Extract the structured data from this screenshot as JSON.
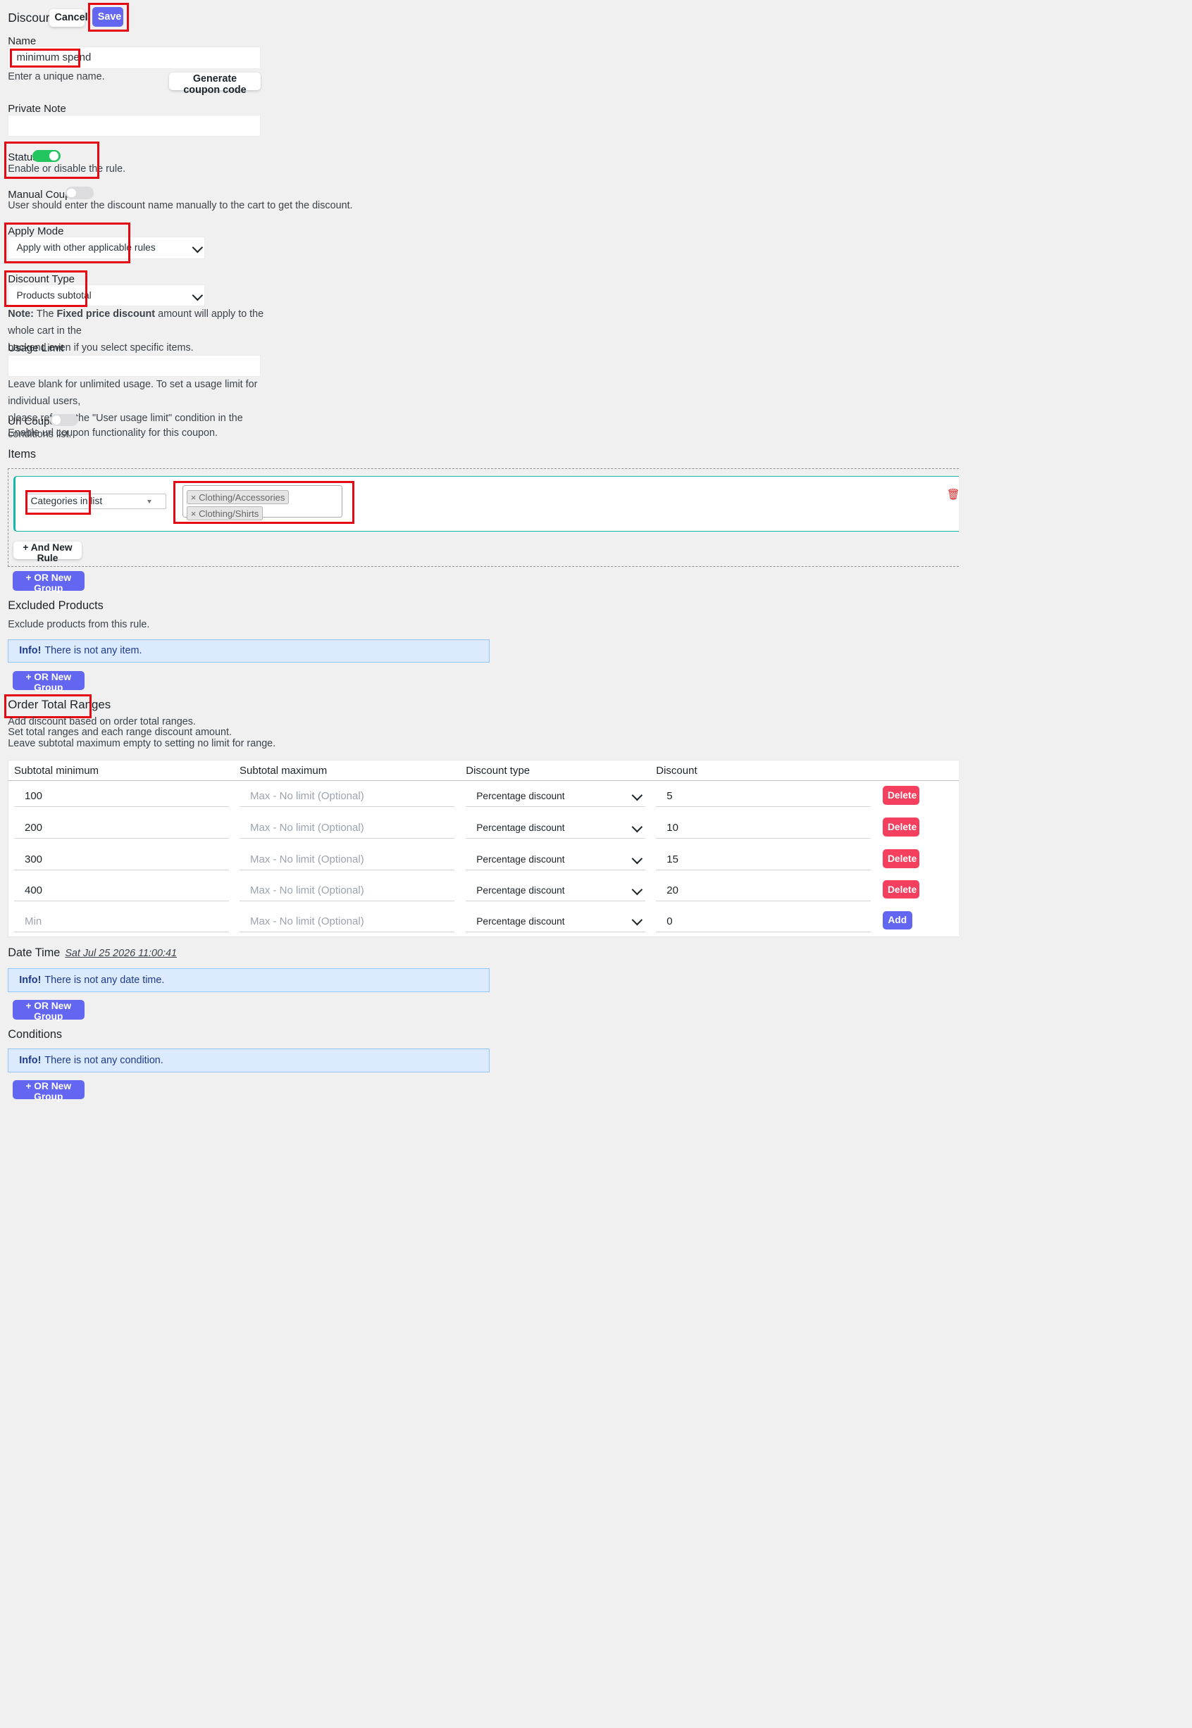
{
  "header": {
    "title": "Discount",
    "cancel_label": "Cancel",
    "save_label": "Save"
  },
  "name": {
    "label": "Name",
    "value": "minimum spend",
    "help": "Enter a unique name.",
    "generate_label": "Generate coupon code"
  },
  "private_note": {
    "label": "Private Note",
    "value": ""
  },
  "status": {
    "label": "Status",
    "enabled": true,
    "help": "Enable or disable the rule."
  },
  "manual_coupon": {
    "label": "Manual Coupon",
    "enabled": false,
    "help": "User should enter the discount name manually to the cart to get the discount."
  },
  "apply_mode": {
    "label": "Apply Mode",
    "value": "Apply with other applicable rules"
  },
  "discount_type": {
    "label": "Discount Type",
    "value": "Products subtotal",
    "note_prefix": "Note:",
    "note_text1": "The",
    "note_bold": "Fixed price discount",
    "note_text2": "amount will apply to the whole cart in the",
    "note_line2": "backend even if you select specific items."
  },
  "usage_limit": {
    "label": "Usage Limit",
    "value": "",
    "help1": "Leave blank for unlimited usage. To set a usage limit for individual users,",
    "help2": "please refer to the \"User usage limit\" condition in the conditions list."
  },
  "url_coupon": {
    "label": "Url Coupon",
    "enabled": false,
    "help": "Enable url coupon functionality for this coupon."
  },
  "items": {
    "title": "Items",
    "rule_type": "Categories in list",
    "tags": [
      "Clothing/Accessories",
      "Clothing/Shirts"
    ],
    "and_rule_label": "+ And New Rule",
    "or_group_label": "+ OR New Group"
  },
  "excluded": {
    "title": "Excluded Products",
    "help": "Exclude products from this rule.",
    "info_bold": "Info!",
    "info_text": "There is not any item.",
    "or_group_label": "+ OR New Group"
  },
  "ranges": {
    "title": "Order Total Ranges",
    "help1": "Add discount based on order total ranges.",
    "help2": "Set total ranges and each range discount amount.",
    "help3": "Leave subtotal maximum empty to setting no limit for range.",
    "columns": [
      "Subtotal minimum",
      "Subtotal maximum",
      "Discount type",
      "Discount"
    ],
    "rows": [
      {
        "min": "100",
        "max_placeholder": "Max - No limit (Optional)",
        "type": "Percentage discount",
        "discount": "5",
        "action": "Delete"
      },
      {
        "min": "200",
        "max_placeholder": "Max - No limit (Optional)",
        "type": "Percentage discount",
        "discount": "10",
        "action": "Delete"
      },
      {
        "min": "300",
        "max_placeholder": "Max - No limit (Optional)",
        "type": "Percentage discount",
        "discount": "15",
        "action": "Delete"
      },
      {
        "min": "400",
        "max_placeholder": "Max - No limit (Optional)",
        "type": "Percentage discount",
        "discount": "20",
        "action": "Delete"
      }
    ],
    "new_row": {
      "min_placeholder": "Min",
      "max_placeholder": "Max - No limit (Optional)",
      "type": "Percentage discount",
      "discount": "0",
      "action": "Add"
    }
  },
  "date_time": {
    "title": "Date Time",
    "current": "Sat Jul 25 2026 11:00:41",
    "info_bold": "Info!",
    "info_text": "There is not any date time.",
    "or_group_label": "+ OR New Group"
  },
  "conditions": {
    "title": "Conditions",
    "info_bold": "Info!",
    "info_text": "There is not any condition.",
    "or_group_label": "+ OR New Group"
  },
  "colors": {
    "primary": "#6366f1",
    "danger": "#f43f5e",
    "toggle_on": "#22c55e",
    "toggle_off": "#dcdcde",
    "accent_border": "#14b8a6",
    "highlight": "#e50914"
  }
}
